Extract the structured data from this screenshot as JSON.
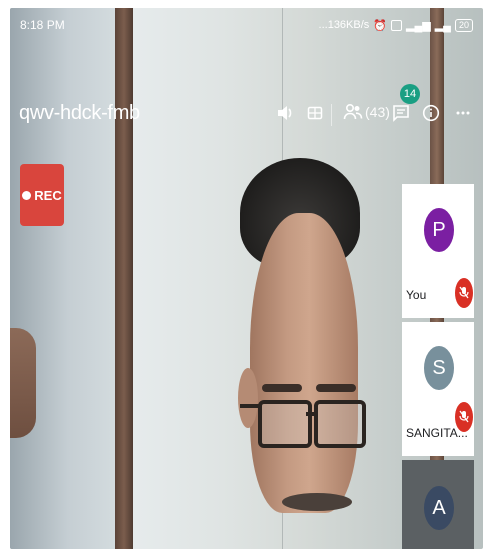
{
  "status_bar": {
    "time": "8:18 PM",
    "network_speed": "...136KB/s",
    "battery": "20"
  },
  "meeting": {
    "code": "qwv-hdck-fmb",
    "participant_count": "(43)",
    "chat_badge": "14",
    "recording_label": "REC"
  },
  "toolbar_icons": [
    "speaker-icon",
    "layout-icon",
    "people-icon",
    "chat-icon",
    "info-icon",
    "more-icon"
  ],
  "tiles": [
    {
      "initial": "P",
      "name": "You",
      "avatar_color": "#7b1fa2",
      "muted": true
    },
    {
      "initial": "S",
      "name": "SANGITA...",
      "avatar_color": "#78909c",
      "muted": true
    },
    {
      "initial": "A",
      "name": "",
      "avatar_color": "#3a4a63",
      "muted": false
    }
  ],
  "colors": {
    "rec": "#d9453d",
    "badge": "#1a9f83",
    "mute": "#d93025"
  }
}
